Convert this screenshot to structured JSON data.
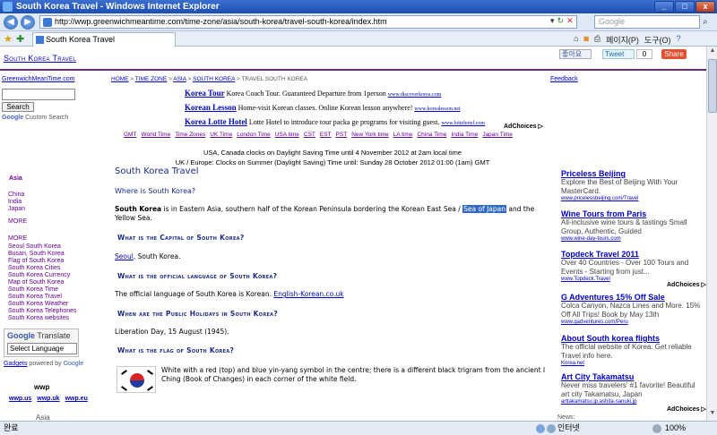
{
  "window": {
    "title": "South Korea Travel - Windows Internet Explorer",
    "buttons": {
      "min": "_",
      "max": "□",
      "close": "x"
    }
  },
  "browser": {
    "url": "http://wwp.greenwichmeantime.com/time-zone/asia/south-korea/travel-south-korea/index.htm",
    "search_placeholder": "Google",
    "tab_title": "South Korea Travel",
    "commands": {
      "page": "페이지(P)",
      "tools": "도구(O)"
    },
    "status_left": "완료",
    "status_zone": "인터넷",
    "status_zoom": "100%"
  },
  "page": {
    "site_title": "South Korea Travel",
    "social": {
      "like": "좋아요",
      "tweet": "Tweet",
      "count": "0",
      "share": "Share"
    },
    "sidebar": {
      "gmt_link": "GreenwichMeanTime.com",
      "search_button": "Search",
      "custom_search": "Custom Search",
      "google": "Google",
      "asia_heading": "Asia",
      "asia_links": [
        "China",
        "India",
        "Japan"
      ],
      "more1": "MORE",
      "more2": "MORE",
      "more_links": [
        "Seoul South Korea",
        "Busan, South Korea",
        "Flag of South Korea",
        "South Korea Cities",
        "South Korea Currency",
        "Map of South Korea",
        "South Korea Time",
        "South Korea Travel",
        "South Korea Weather",
        "South Korea Telephones",
        "South Korea websites"
      ],
      "translate_google": "Google",
      "translate_label": "Translate",
      "select_language": "Select Language",
      "gadgets": "Gadgets",
      "powered_by": "powered by",
      "powered_google": "Google",
      "wwp_title": "wwp",
      "wwp_links": [
        "wwp.us",
        "wwp.uk",
        "wwp.eu"
      ],
      "asia_footer": "Asia"
    },
    "breadcrumb": [
      "HOME",
      "TIME ZONE",
      "ASIA",
      "SOUTH KOREA",
      "TRAVEL SOUTH KOREA"
    ],
    "breadcrumb_sep": " > ",
    "feedback": "Feedback",
    "top_ads": [
      {
        "title": "Korea Tour",
        "desc": "Korea Coach Tour. Guaranteed Departure from 1person",
        "url": "www.discoverkorea.com"
      },
      {
        "title": "Korean Lesson",
        "desc": "Home-visit Korean classes. Online Korean lesson anywhere!",
        "url": "www.korealesson.net"
      },
      {
        "title": "Korea Lotte Hotel",
        "desc": "Lotte Hotel to introduce tour packa ge programs for visiting guest.",
        "url": "www.lottehotel.com"
      }
    ],
    "adchoices": "AdChoices",
    "time_links": [
      "GMT",
      "World Time",
      "Time Zones",
      "UK Time",
      "London Time",
      "USA time",
      "CST",
      "EST",
      "PST",
      "New York time",
      "LA time",
      "China Time",
      "India Time",
      "Japan Time"
    ],
    "dst_line1": "USA, Canada clocks on Daylight Saving Time until 4 November 2012 at 2am local time",
    "dst_line2": "UK / Europe: Clocks on Summer (Daylight Saving) Time until: Sunday 28 October 2012 01:00 (1am) GMT",
    "heading": "South Korea Travel",
    "where_heading": "Where is South Korea?",
    "where_bold": "South Korea",
    "where_text_a": " is in Eastern Asia, southern half of the Korean Peninsula bordering the Korean East Sea / ",
    "where_highlight": "Sea of Japan",
    "where_text_b": " and the Yellow Sea.",
    "capital_heading": "What is the Capital of South Korea?",
    "capital_link": "Seoul",
    "capital_text": ", South Korea.",
    "language_heading": "What is the official language of South Korea?",
    "language_text": "The official language of South Korea is Korean. ",
    "language_link": "English-Korean.co.uk",
    "holidays_heading": "When are the Public Holidays in South Korea?",
    "holidays_text": "Liberation Day, 15 August (1945).",
    "flag_heading": "What is the flag of South Korea?",
    "flag_text": "White with a red (top) and blue yin-yang symbol in the centre; there is a different black trigram from the ancient I Ching (Book of Changes) in each corner of the white field.",
    "right_ads": [
      {
        "title": "Priceless Beijing",
        "desc": "Explore the Best of Beijing With Your MasterCard.",
        "url": "www.pricelessbeijing.com/Travel"
      },
      {
        "title": "Wine Tours from Paris",
        "desc": "All-inclusive wine tours & tastings Small Group, Authentic, Guided",
        "url": "www.wine-day-tours.com"
      },
      {
        "title": "Topdeck Travel 2011",
        "desc": "Over 40 Countries - Over 100 Tours and Events - Starting from just...",
        "url": "www.Topdeck.Travel"
      },
      {
        "title": "G Adventures 15% Off Sale",
        "desc": "Colca Canyon, Nazca Lines and More. 15% Off All Trips! Book by May 13th",
        "url": "www.gadventures.com/Peru"
      },
      {
        "title": "About South korea flights",
        "desc": "The official website of Korea. Get reliable Travel info here.",
        "url": "Korea.net"
      },
      {
        "title": "Art City Takamatsu",
        "desc": "Never miss travelers' #1 favorite! Beautiful art city Takamatsu, Japan",
        "url": "arttakamatsu.jp.ashita-sanuki.jp"
      }
    ],
    "footer_news": "News:"
  }
}
